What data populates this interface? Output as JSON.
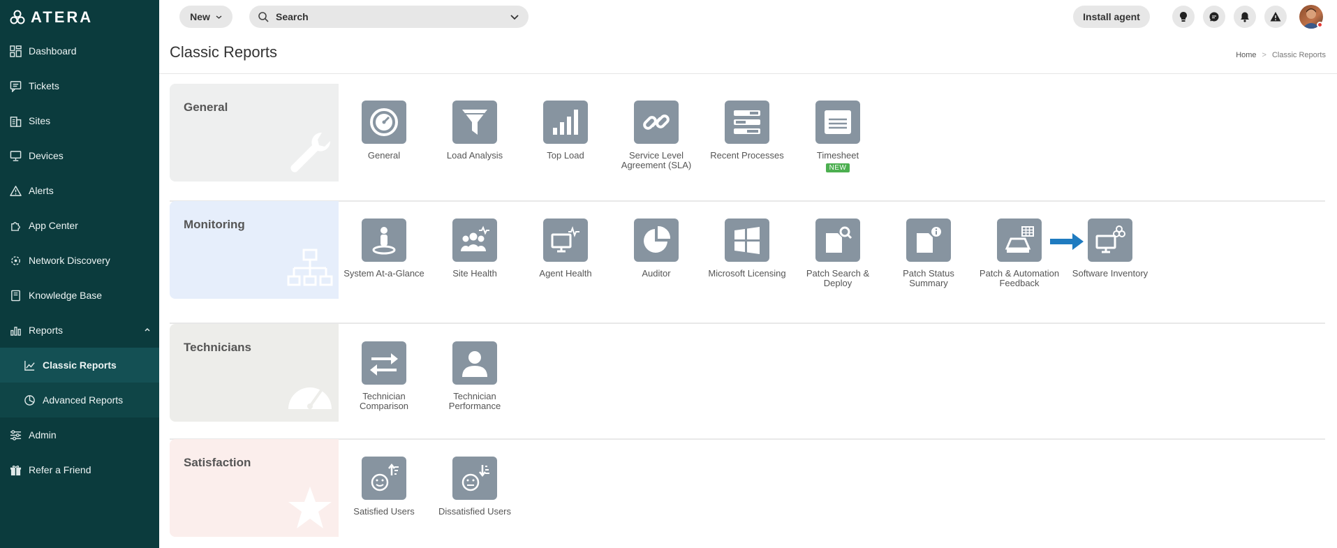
{
  "app": {
    "logo_text": "ATERA"
  },
  "sidebar": {
    "items": [
      {
        "label": "Dashboard",
        "icon": "dashboard-icon"
      },
      {
        "label": "Tickets",
        "icon": "tickets-icon"
      },
      {
        "label": "Sites",
        "icon": "sites-icon"
      },
      {
        "label": "Devices",
        "icon": "devices-icon"
      },
      {
        "label": "Alerts",
        "icon": "alerts-icon"
      },
      {
        "label": "App Center",
        "icon": "app-center-icon"
      },
      {
        "label": "Network Discovery",
        "icon": "network-discovery-icon"
      },
      {
        "label": "Knowledge Base",
        "icon": "knowledge-base-icon"
      },
      {
        "label": "Reports",
        "icon": "reports-icon"
      },
      {
        "label": "Classic Reports",
        "icon": "classic-reports-icon"
      },
      {
        "label": "Advanced Reports",
        "icon": "advanced-reports-icon"
      },
      {
        "label": "Admin",
        "icon": "admin-icon"
      },
      {
        "label": "Refer a Friend",
        "icon": "gift-icon"
      }
    ]
  },
  "topbar": {
    "new_label": "New",
    "search_label": "Search",
    "install_label": "Install agent"
  },
  "page": {
    "title": "Classic Reports",
    "breadcrumb": {
      "home": "Home",
      "sep": ">",
      "current": "Classic Reports"
    }
  },
  "sections": {
    "general": {
      "title": "General",
      "tiles": [
        "General",
        "Load Analysis",
        "Top Load",
        "Service Level Agreement (SLA)",
        "Recent Processes",
        "Timesheet"
      ],
      "new_badge": "NEW"
    },
    "monitoring": {
      "title": "Monitoring",
      "tiles": [
        "System At-a-Glance",
        "Site Health",
        "Agent Health",
        "Auditor",
        "Microsoft Licensing",
        "Patch Search & Deploy",
        "Patch Status Summary",
        "Patch & Automation Feedback",
        "Software Inventory"
      ]
    },
    "technicians": {
      "title": "Technicians",
      "tiles": [
        "Technician Comparison",
        "Technician Performance"
      ]
    },
    "satisfaction": {
      "title": "Satisfaction",
      "tiles": [
        "Satisfied Users",
        "Dissatisfied Users"
      ]
    }
  },
  "colors": {
    "sidebar_bg": "#0b3b3d",
    "tile_bg": "#8794a0",
    "general_bg": "#eeefef",
    "monitoring_bg": "#e6eefb",
    "technicians_bg": "#ededea",
    "satisfaction_bg": "#fbeeec",
    "new_badge": "#4caf50",
    "arrow": "#1f7bc0"
  }
}
